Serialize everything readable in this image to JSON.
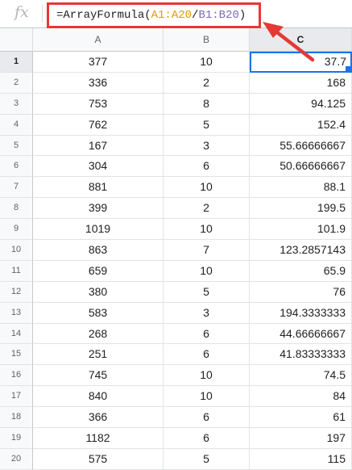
{
  "formula_bar": {
    "fx_icon": "fx-icon",
    "formula_parts": [
      "=ArrayFormula(",
      "A1:A20",
      "/",
      "B1:B20",
      ")"
    ]
  },
  "columns": [
    "A",
    "B",
    "C"
  ],
  "selected_cell": "C1",
  "colors": {
    "highlight_box": "#e53935",
    "arrow": "#e53935",
    "range_a": "#e69a00",
    "range_b": "#7f68b8",
    "selection": "#1a73e8"
  },
  "rows": [
    {
      "n": "1",
      "a": "377",
      "b": "10",
      "c": "37.7"
    },
    {
      "n": "2",
      "a": "336",
      "b": "2",
      "c": "168"
    },
    {
      "n": "3",
      "a": "753",
      "b": "8",
      "c": "94.125"
    },
    {
      "n": "4",
      "a": "762",
      "b": "5",
      "c": "152.4"
    },
    {
      "n": "5",
      "a": "167",
      "b": "3",
      "c": "55.66666667"
    },
    {
      "n": "6",
      "a": "304",
      "b": "6",
      "c": "50.66666667"
    },
    {
      "n": "7",
      "a": "881",
      "b": "10",
      "c": "88.1"
    },
    {
      "n": "8",
      "a": "399",
      "b": "2",
      "c": "199.5"
    },
    {
      "n": "9",
      "a": "1019",
      "b": "10",
      "c": "101.9"
    },
    {
      "n": "10",
      "a": "863",
      "b": "7",
      "c": "123.2857143"
    },
    {
      "n": "11",
      "a": "659",
      "b": "10",
      "c": "65.9"
    },
    {
      "n": "12",
      "a": "380",
      "b": "5",
      "c": "76"
    },
    {
      "n": "13",
      "a": "583",
      "b": "3",
      "c": "194.3333333"
    },
    {
      "n": "14",
      "a": "268",
      "b": "6",
      "c": "44.66666667"
    },
    {
      "n": "15",
      "a": "251",
      "b": "6",
      "c": "41.83333333"
    },
    {
      "n": "16",
      "a": "745",
      "b": "10",
      "c": "74.5"
    },
    {
      "n": "17",
      "a": "840",
      "b": "10",
      "c": "84"
    },
    {
      "n": "18",
      "a": "366",
      "b": "6",
      "c": "61"
    },
    {
      "n": "19",
      "a": "1182",
      "b": "6",
      "c": "197"
    },
    {
      "n": "20",
      "a": "575",
      "b": "5",
      "c": "115"
    }
  ]
}
